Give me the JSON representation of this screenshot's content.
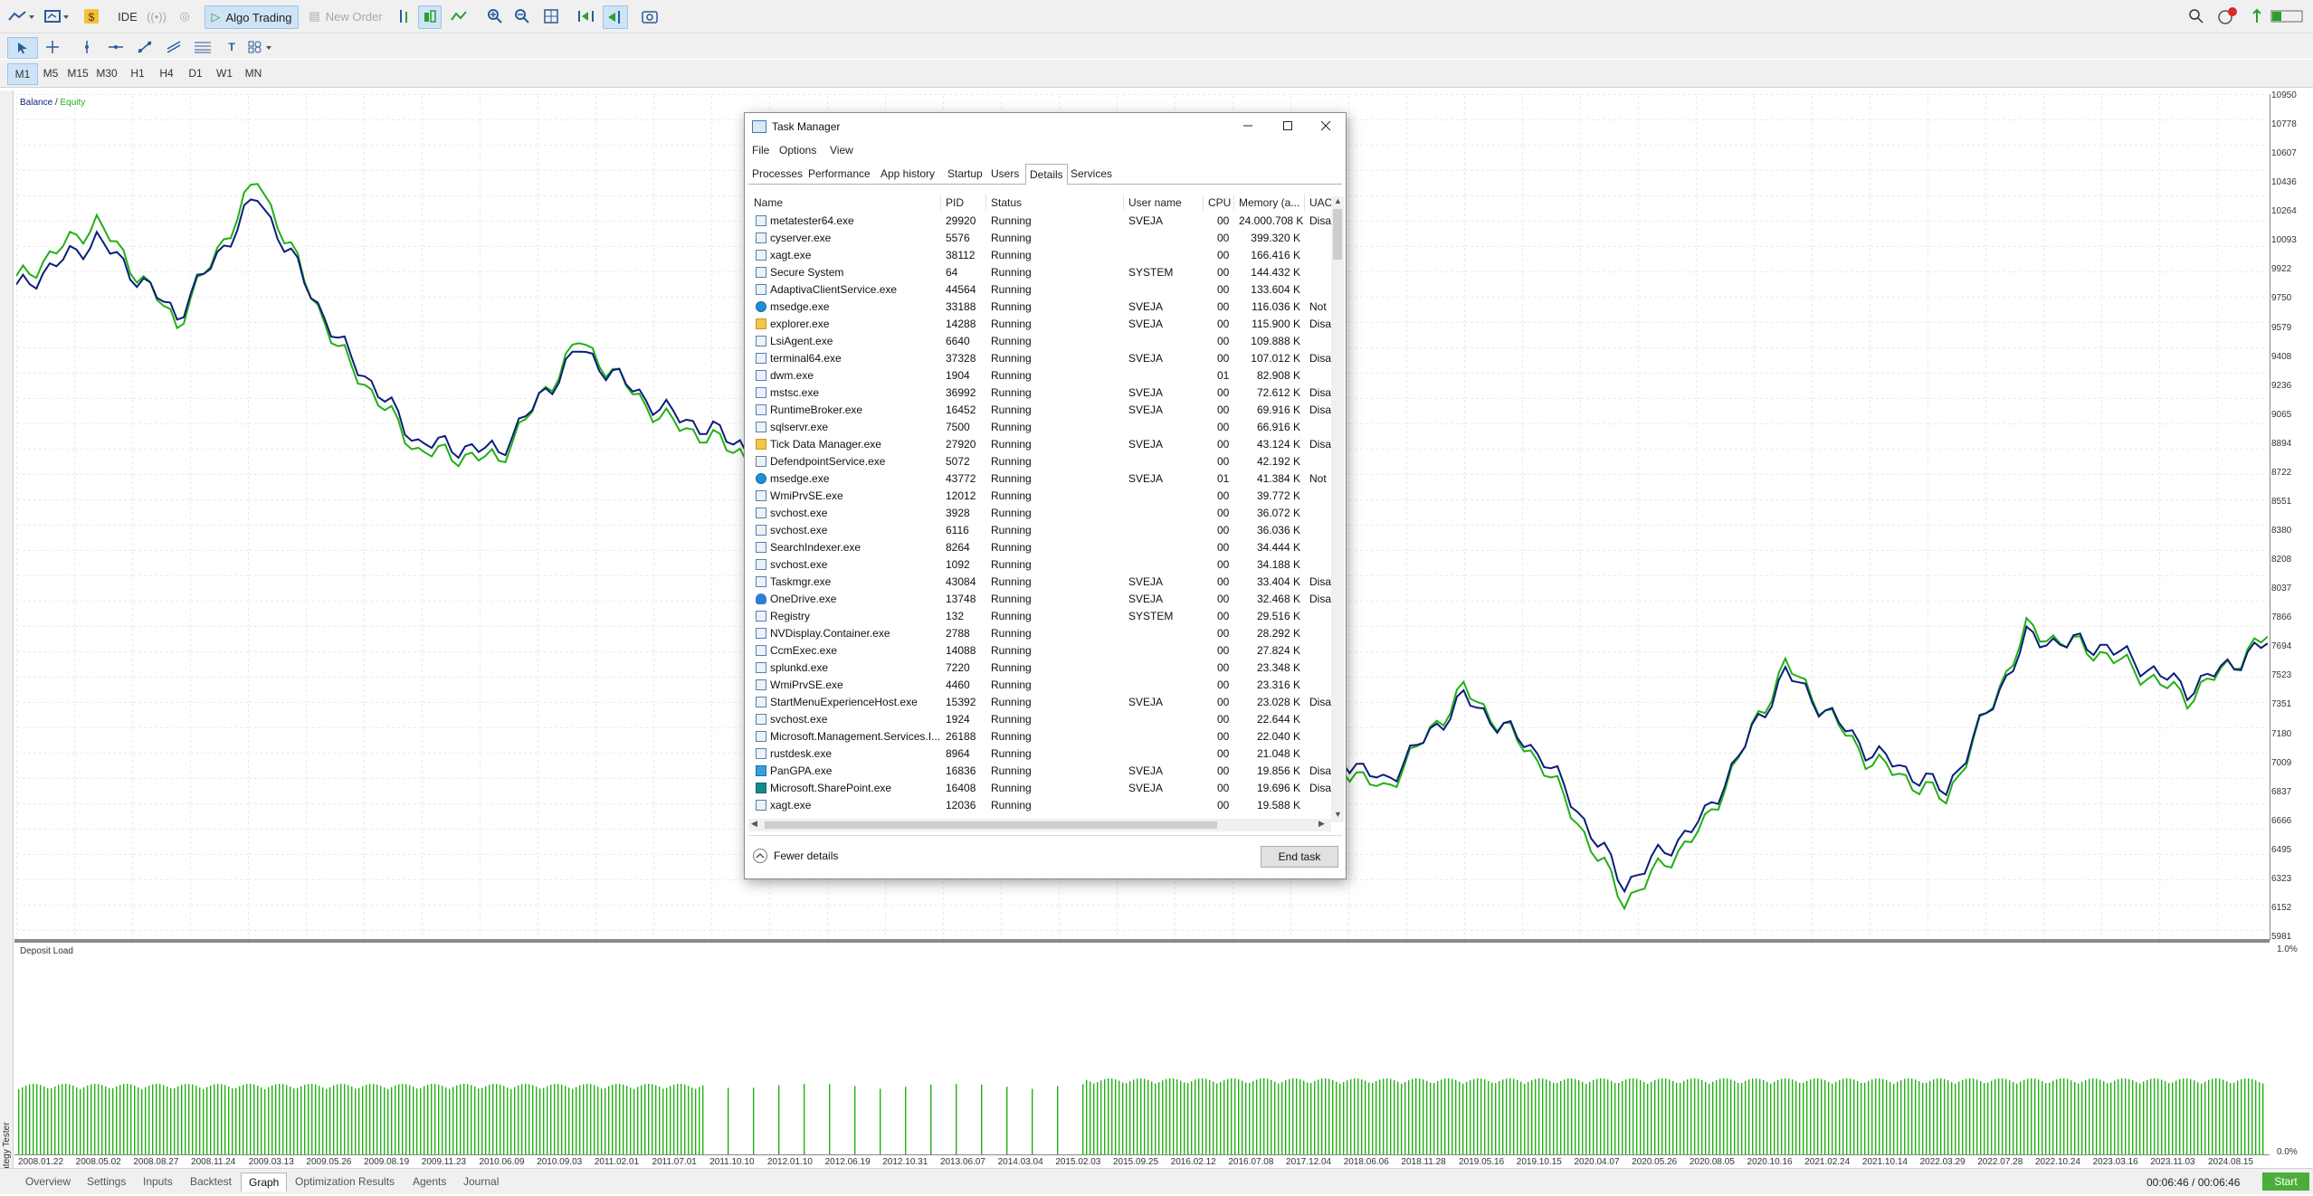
{
  "toolbar": {
    "ide_label": "IDE",
    "algo_label": "Algo Trading",
    "neworder_label": "New Order"
  },
  "timeframes": [
    "M1",
    "M5",
    "M15",
    "M30",
    "H1",
    "H4",
    "D1",
    "W1",
    "MN"
  ],
  "chart": {
    "legend_balance": "Balance",
    "legend_sep": " / ",
    "legend_equity": "Equity",
    "lower_label": "Deposit Load",
    "y_labels": [
      "10950",
      "10778",
      "10607",
      "10436",
      "10264",
      "10093",
      "9922",
      "9750",
      "9579",
      "9408",
      "9236",
      "9065",
      "8894",
      "8722",
      "8551",
      "8380",
      "8208",
      "8037",
      "7866",
      "7694",
      "7523",
      "7351",
      "7180",
      "7009",
      "6837",
      "6666",
      "6495",
      "6323",
      "6152",
      "5981"
    ],
    "x_labels": [
      "2008.01.22",
      "2008.05.02",
      "2008.08.27",
      "2008.11.24",
      "2009.03.13",
      "2009.05.26",
      "2009.08.19",
      "2009.11.23",
      "2010.06.09",
      "2010.09.03",
      "2011.02.01",
      "2011.07.01",
      "2011.10.10",
      "2012.01.10",
      "2012.06.19",
      "2012.10.31",
      "2013.06.07",
      "2014.03.04",
      "2015.02.03",
      "2015.09.25",
      "2016.02.12",
      "2016.07.08",
      "2017.12.04",
      "2018.06.06",
      "2018.11.28",
      "2019.05.16",
      "2019.10.15",
      "2020.04.07",
      "2020.05.26",
      "2020.08.05",
      "2020.10.16",
      "2021.02.24",
      "2021.10.14",
      "2022.03.29",
      "2022.07.28",
      "2022.10.24",
      "2023.03.16",
      "2023.11.03",
      "2024.08.15"
    ],
    "load_top": "1.0%",
    "load_bottom": "0.0%",
    "balance_color": "#0b1e7a",
    "equity_color": "#22b014"
  },
  "chart_data": {
    "type": "line",
    "series": [
      {
        "name": "Balance",
        "values": [
          9800,
          10100,
          9650,
          10350,
          9500,
          8900,
          8850,
          9450,
          9100,
          8900,
          8400,
          7600,
          6800,
          6500,
          7150,
          7300,
          7200,
          6900,
          7400,
          7050,
          6300,
          6700,
          7550,
          7100,
          6850,
          7750,
          7700,
          7450,
          7720
        ]
      },
      {
        "name": "Equity",
        "values": [
          9850,
          10200,
          9600,
          10450,
          9450,
          8850,
          8800,
          9500,
          9050,
          8850,
          8350,
          7550,
          6750,
          6450,
          7200,
          7350,
          7150,
          6850,
          7450,
          7000,
          6200,
          6650,
          7600,
          7050,
          6800,
          7800,
          7650,
          7400,
          7760
        ]
      }
    ],
    "ylim": [
      5981,
      10950
    ]
  },
  "task_manager": {
    "title": "Task Manager",
    "menu": [
      "File",
      "Options",
      "View"
    ],
    "tabs": [
      "Processes",
      "Performance",
      "App history",
      "Startup",
      "Users",
      "Details",
      "Services"
    ],
    "columns": [
      "Name",
      "PID",
      "Status",
      "User name",
      "CPU",
      "Memory (a...",
      "UAC"
    ],
    "rows": [
      [
        "metatester64.exe",
        "29920",
        "Running",
        "SVEJA",
        "00",
        "24.000.708 K",
        "Disa"
      ],
      [
        "cyserver.exe",
        "5576",
        "Running",
        "",
        "00",
        "399.320 K",
        ""
      ],
      [
        "xagt.exe",
        "38112",
        "Running",
        "",
        "00",
        "166.416 K",
        ""
      ],
      [
        "Secure System",
        "64",
        "Running",
        "SYSTEM",
        "00",
        "144.432 K",
        ""
      ],
      [
        "AdaptivaClientService.exe",
        "44564",
        "Running",
        "",
        "00",
        "133.604 K",
        ""
      ],
      [
        "msedge.exe",
        "33188",
        "Running",
        "SVEJA",
        "00",
        "116.036 K",
        "Not"
      ],
      [
        "explorer.exe",
        "14288",
        "Running",
        "SVEJA",
        "00",
        "115.900 K",
        "Disa"
      ],
      [
        "LsiAgent.exe",
        "6640",
        "Running",
        "",
        "00",
        "109.888 K",
        ""
      ],
      [
        "terminal64.exe",
        "37328",
        "Running",
        "SVEJA",
        "00",
        "107.012 K",
        "Disa"
      ],
      [
        "dwm.exe",
        "1904",
        "Running",
        "",
        "01",
        "82.908 K",
        ""
      ],
      [
        "mstsc.exe",
        "36992",
        "Running",
        "SVEJA",
        "00",
        "72.612 K",
        "Disa"
      ],
      [
        "RuntimeBroker.exe",
        "16452",
        "Running",
        "SVEJA",
        "00",
        "69.916 K",
        "Disa"
      ],
      [
        "sqlservr.exe",
        "7500",
        "Running",
        "",
        "00",
        "66.916 K",
        ""
      ],
      [
        "Tick Data Manager.exe",
        "27920",
        "Running",
        "SVEJA",
        "00",
        "43.124 K",
        "Disa"
      ],
      [
        "DefendpointService.exe",
        "5072",
        "Running",
        "",
        "00",
        "42.192 K",
        ""
      ],
      [
        "msedge.exe",
        "43772",
        "Running",
        "SVEJA",
        "01",
        "41.384 K",
        "Not"
      ],
      [
        "WmiPrvSE.exe",
        "12012",
        "Running",
        "",
        "00",
        "39.772 K",
        ""
      ],
      [
        "svchost.exe",
        "3928",
        "Running",
        "",
        "00",
        "36.072 K",
        ""
      ],
      [
        "svchost.exe",
        "6116",
        "Running",
        "",
        "00",
        "36.036 K",
        ""
      ],
      [
        "SearchIndexer.exe",
        "8264",
        "Running",
        "",
        "00",
        "34.444 K",
        ""
      ],
      [
        "svchost.exe",
        "1092",
        "Running",
        "",
        "00",
        "34.188 K",
        ""
      ],
      [
        "Taskmgr.exe",
        "43084",
        "Running",
        "SVEJA",
        "00",
        "33.404 K",
        "Disa"
      ],
      [
        "OneDrive.exe",
        "13748",
        "Running",
        "SVEJA",
        "00",
        "32.468 K",
        "Disa"
      ],
      [
        "Registry",
        "132",
        "Running",
        "SYSTEM",
        "00",
        "29.516 K",
        ""
      ],
      [
        "NVDisplay.Container.exe",
        "2788",
        "Running",
        "",
        "00",
        "28.292 K",
        ""
      ],
      [
        "CcmExec.exe",
        "14088",
        "Running",
        "",
        "00",
        "27.824 K",
        ""
      ],
      [
        "splunkd.exe",
        "7220",
        "Running",
        "",
        "00",
        "23.348 K",
        ""
      ],
      [
        "WmiPrvSE.exe",
        "4460",
        "Running",
        "",
        "00",
        "23.316 K",
        ""
      ],
      [
        "StartMenuExperienceHost.exe",
        "15392",
        "Running",
        "SVEJA",
        "00",
        "23.028 K",
        "Disa"
      ],
      [
        "svchost.exe",
        "1924",
        "Running",
        "",
        "00",
        "22.644 K",
        ""
      ],
      [
        "Microsoft.Management.Services.I...",
        "26188",
        "Running",
        "",
        "00",
        "22.040 K",
        ""
      ],
      [
        "rustdesk.exe",
        "8964",
        "Running",
        "",
        "00",
        "21.048 K",
        ""
      ],
      [
        "PanGPA.exe",
        "16836",
        "Running",
        "SVEJA",
        "00",
        "19.856 K",
        "Disa"
      ],
      [
        "Microsoft.SharePoint.exe",
        "16408",
        "Running",
        "SVEJA",
        "00",
        "19.696 K",
        "Disa"
      ],
      [
        "xagt.exe",
        "12036",
        "Running",
        "",
        "00",
        "19.588 K",
        ""
      ]
    ],
    "row_icons": [
      "gear",
      "app",
      "app",
      "app",
      "app",
      "edge",
      "fold",
      "app",
      "gear",
      "app",
      "app",
      "app",
      "app",
      "fold",
      "app",
      "edge",
      "app",
      "app",
      "app",
      "app",
      "app",
      "app",
      "cloud",
      "app",
      "app",
      "app",
      "app",
      "app",
      "app",
      "app",
      "app",
      "app",
      "gp",
      "sp",
      "app"
    ],
    "fewer_details": "Fewer details",
    "end_task": "End task"
  },
  "bottom_tabs": [
    "Overview",
    "Settings",
    "Inputs",
    "Backtest",
    "Graph",
    "Optimization Results",
    "Agents",
    "Journal"
  ],
  "side_label": "Strategy Tester",
  "status": {
    "time": "00:06:46 / 00:06:46",
    "start_label": "Start"
  }
}
